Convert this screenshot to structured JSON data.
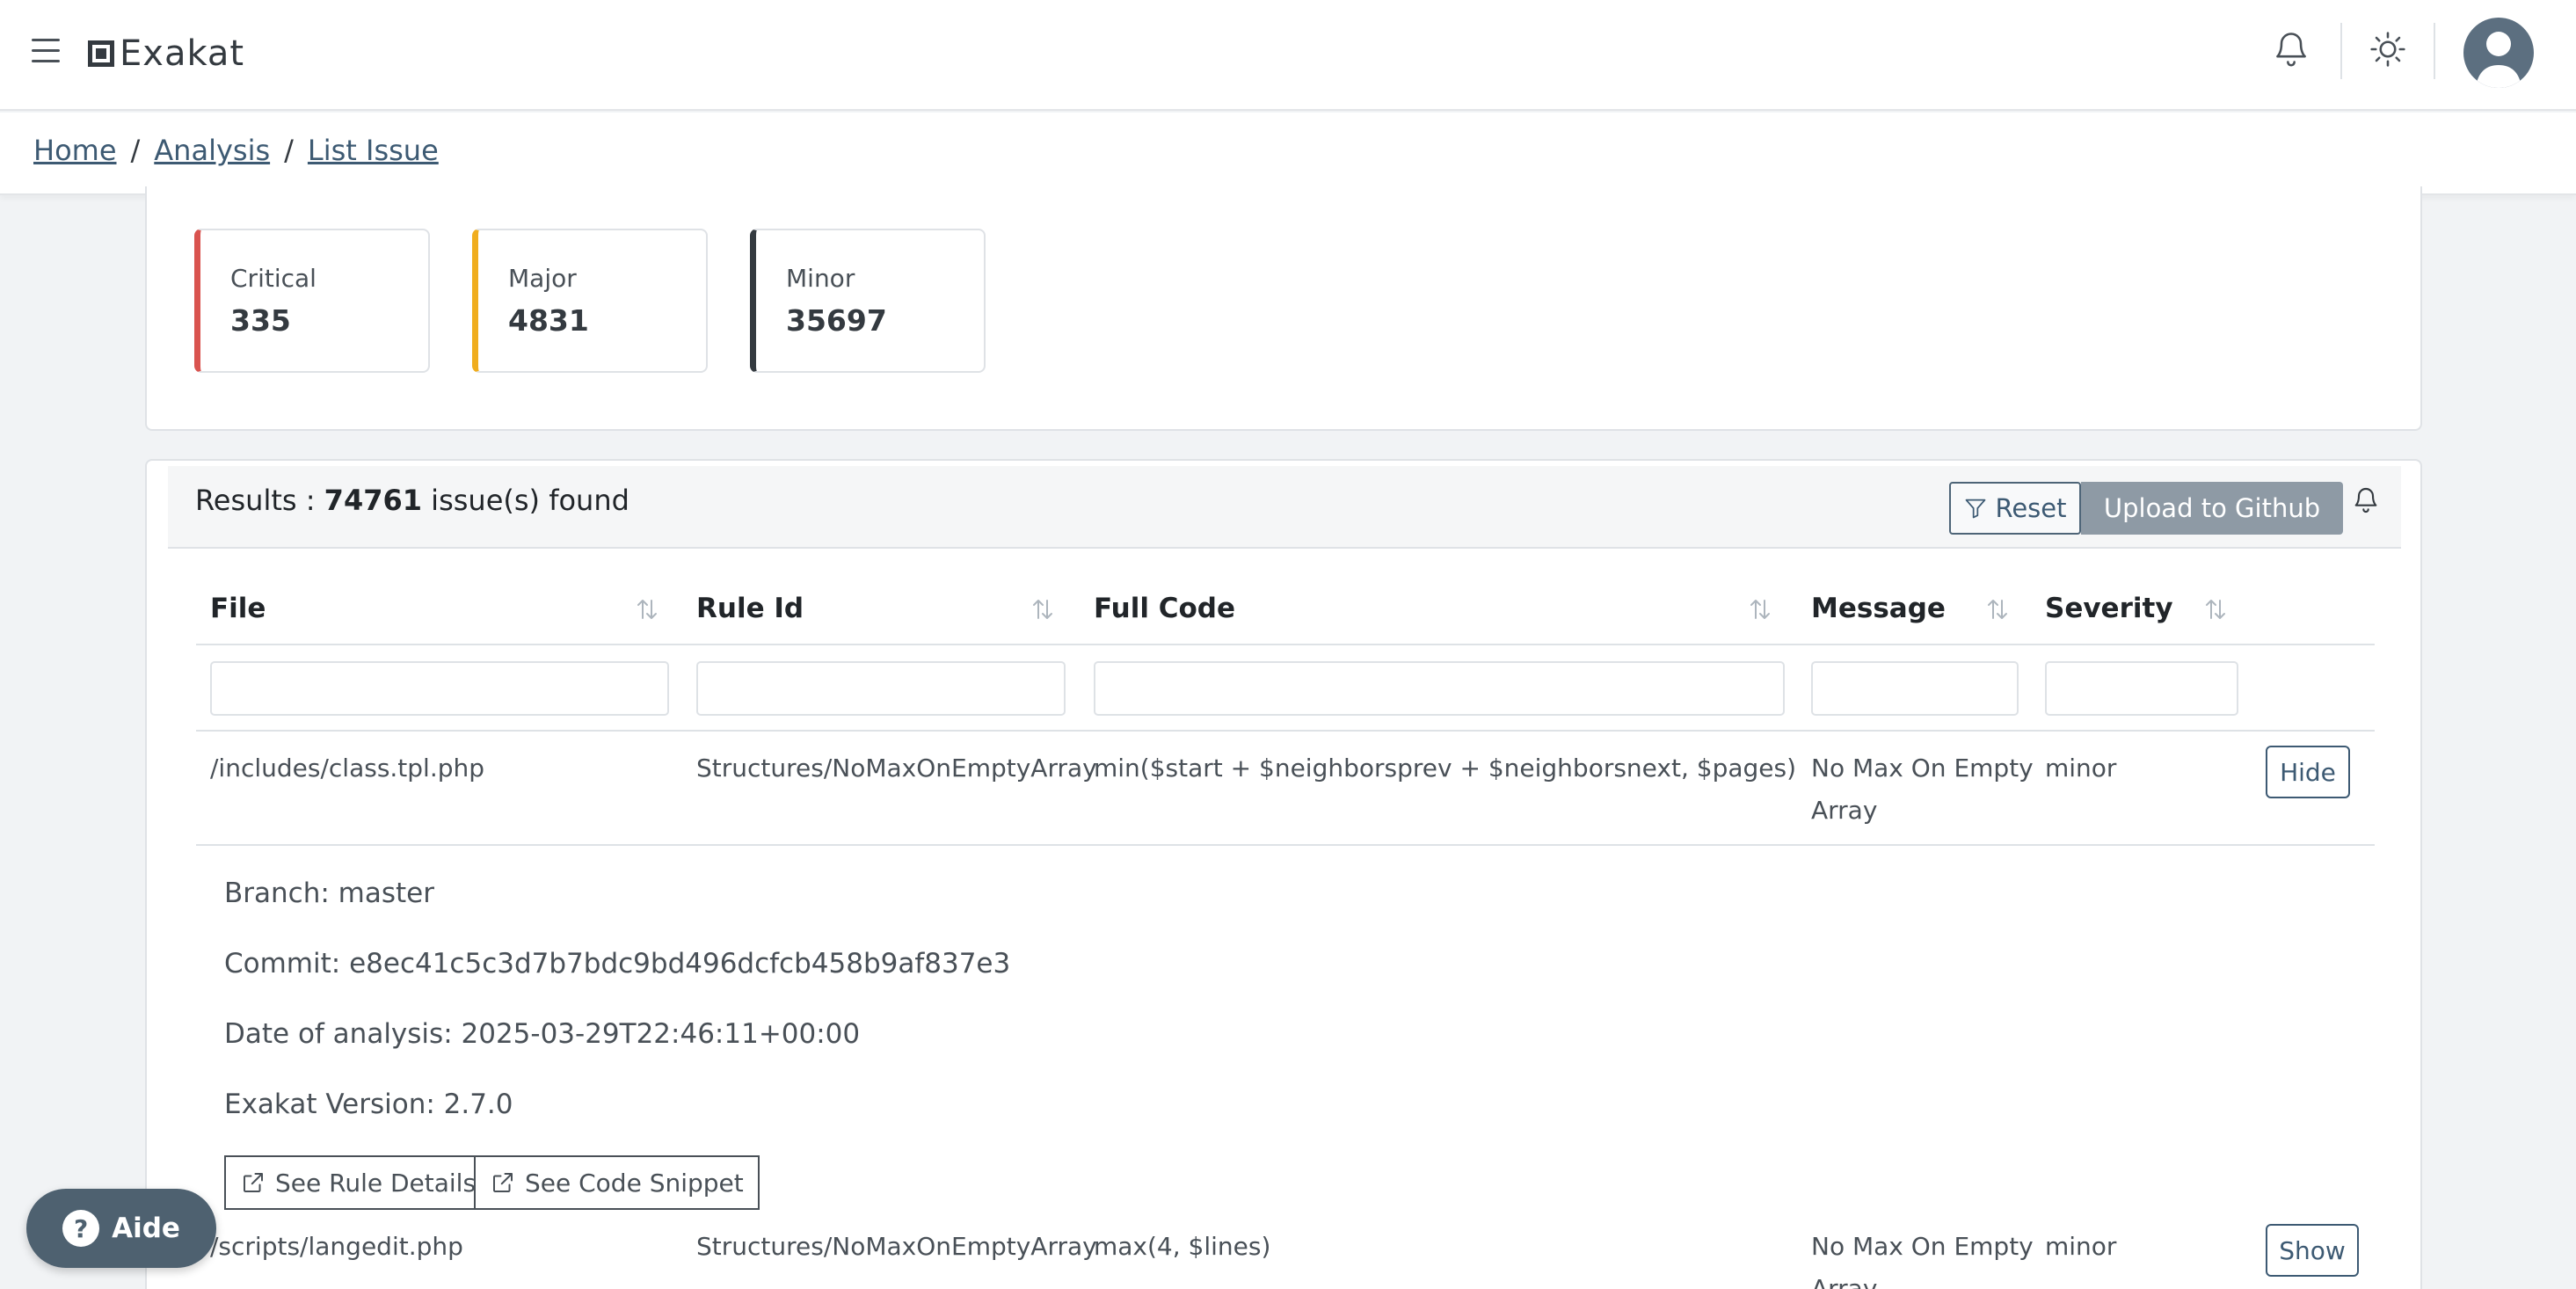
{
  "header": {
    "brand": "Exakat"
  },
  "breadcrumb": [
    "Home",
    "Analysis",
    "List Issue"
  ],
  "summary": [
    {
      "label": "Critical",
      "value": "335",
      "color": "#d9534f"
    },
    {
      "label": "Major",
      "value": "4831",
      "color": "#f0ad1e"
    },
    {
      "label": "Minor",
      "value": "35697",
      "color": "#343a40"
    }
  ],
  "results": {
    "prefix": "Results : ",
    "count": "74761",
    "suffix": " issue(s) found",
    "reset_label": "Reset",
    "upload_label": "Upload to Github"
  },
  "table": {
    "columns": [
      "File",
      "Rule Id",
      "Full Code",
      "Message",
      "Severity"
    ],
    "rows": [
      {
        "file": "/includes/class.tpl.php",
        "rule": "Structures/NoMaxOnEmptyArray",
        "code": "min($start + $neighborsprev + $neighborsnext, $pages)",
        "message_line1": "No Max On Empty",
        "message_line2": "Array",
        "severity": "minor",
        "action": "Hide"
      },
      {
        "file": "/scripts/langedit.php",
        "rule": "Structures/NoMaxOnEmptyArray",
        "code": "max(4, $lines)",
        "message_line1": "No Max On Empty",
        "message_line2": "Array",
        "severity": "minor",
        "action": "Show"
      }
    ]
  },
  "details": {
    "branch": "Branch: master",
    "commit": "Commit: e8ec41c5c3d7b7bdc9bd496dcfcb458b9af837e3",
    "date": "Date of analysis: 2025-03-29T22:46:11+00:00",
    "version": "Exakat Version: 2.7.0",
    "rule_details_label": "See Rule Details",
    "code_snippet_label": "See Code Snippet"
  },
  "aide": {
    "label": "Aide"
  }
}
